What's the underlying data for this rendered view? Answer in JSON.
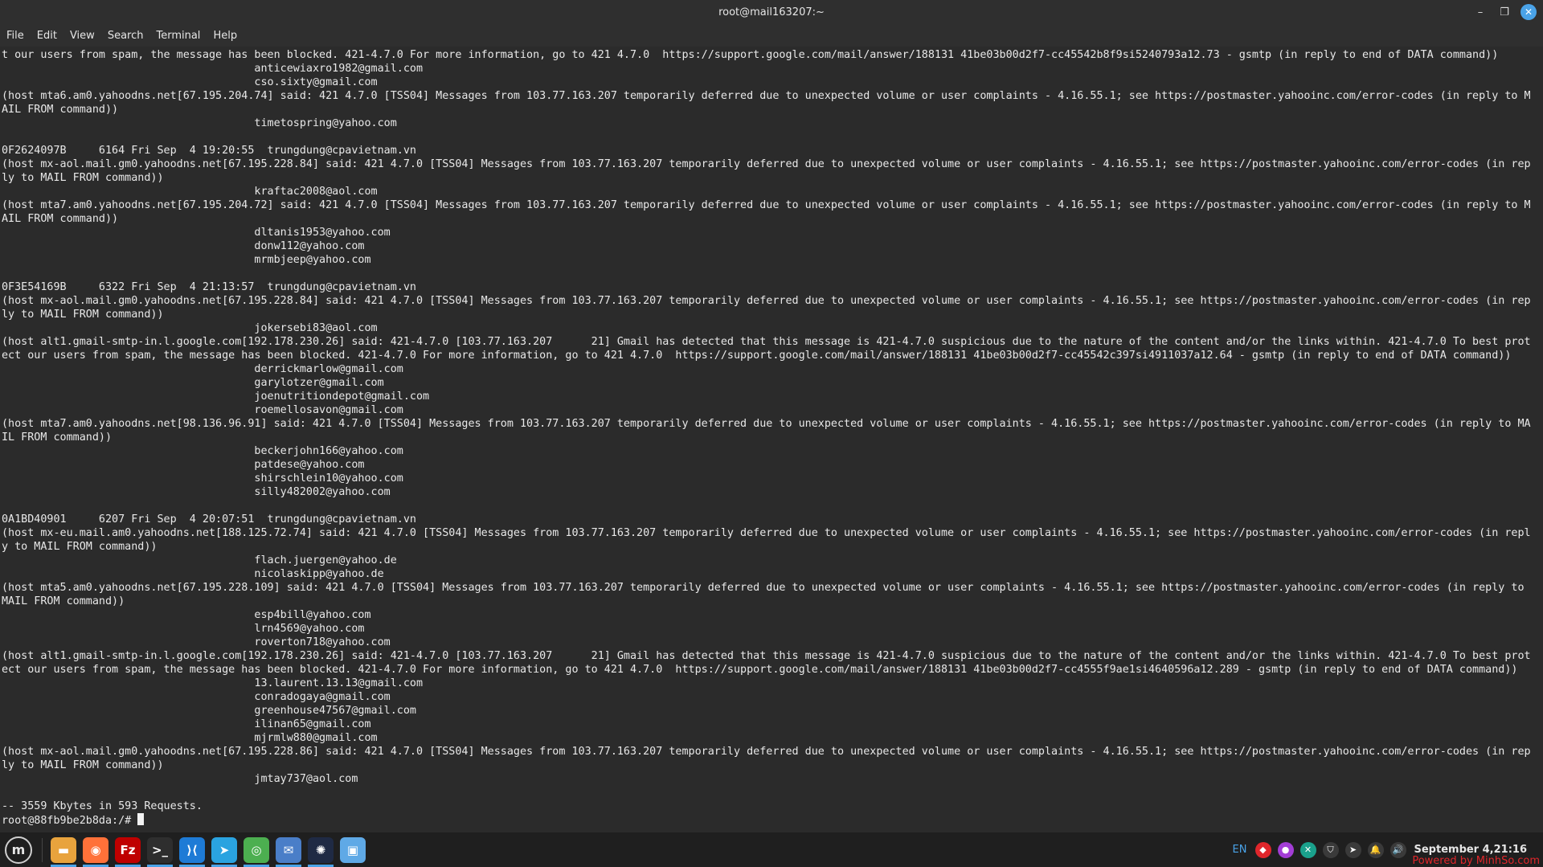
{
  "window": {
    "title": "root@mail163207:~"
  },
  "menu": {
    "items": [
      "File",
      "Edit",
      "View",
      "Search",
      "Terminal",
      "Help"
    ]
  },
  "terminal": {
    "lines": [
      "t our users from spam, the message has been blocked. 421-4.7.0 For more information, go to 421 4.7.0  https://support.google.com/mail/answer/188131 41be03b00d2f7-cc45542b8f9si5240793a12.73 - gsmtp (in reply to end of DATA command))",
      "                                       anticewiaxro1982@gmail.com",
      "                                       cso.sixty@gmail.com",
      "(host mta6.am0.yahoodns.net[67.195.204.74] said: 421 4.7.0 [TSS04] Messages from 103.77.163.207 temporarily deferred due to unexpected volume or user complaints - 4.16.55.1; see https://postmaster.yahooinc.com/error-codes (in reply to MAIL FROM command))",
      "                                       timetospring@yahoo.com",
      "",
      "0F2624097B     6164 Fri Sep  4 19:20:55  trungdung@cpavietnam.vn",
      "(host mx-aol.mail.gm0.yahoodns.net[67.195.228.84] said: 421 4.7.0 [TSS04] Messages from 103.77.163.207 temporarily deferred due to unexpected volume or user complaints - 4.16.55.1; see https://postmaster.yahooinc.com/error-codes (in reply to MAIL FROM command))",
      "                                       kraftac2008@aol.com",
      "(host mta7.am0.yahoodns.net[67.195.204.72] said: 421 4.7.0 [TSS04] Messages from 103.77.163.207 temporarily deferred due to unexpected volume or user complaints - 4.16.55.1; see https://postmaster.yahooinc.com/error-codes (in reply to MAIL FROM command))",
      "                                       dltanis1953@yahoo.com",
      "                                       donw112@yahoo.com",
      "                                       mrmbjeep@yahoo.com",
      "",
      "0F3E54169B     6322 Fri Sep  4 21:13:57  trungdung@cpavietnam.vn",
      "(host mx-aol.mail.gm0.yahoodns.net[67.195.228.84] said: 421 4.7.0 [TSS04] Messages from 103.77.163.207 temporarily deferred due to unexpected volume or user complaints - 4.16.55.1; see https://postmaster.yahooinc.com/error-codes (in reply to MAIL FROM command))",
      "                                       jokersebi83@aol.com",
      "(host alt1.gmail-smtp-in.l.google.com[192.178.230.26] said: 421-4.7.0 [103.77.163.207      21] Gmail has detected that this message is 421-4.7.0 suspicious due to the nature of the content and/or the links within. 421-4.7.0 To best protect our users from spam, the message has been blocked. 421-4.7.0 For more information, go to 421 4.7.0  https://support.google.com/mail/answer/188131 41be03b00d2f7-cc45542c397si4911037a12.64 - gsmtp (in reply to end of DATA command))",
      "                                       derrickmarlow@gmail.com",
      "                                       garylotzer@gmail.com",
      "                                       joenutritiondepot@gmail.com",
      "                                       roemellosavon@gmail.com",
      "(host mta7.am0.yahoodns.net[98.136.96.91] said: 421 4.7.0 [TSS04] Messages from 103.77.163.207 temporarily deferred due to unexpected volume or user complaints - 4.16.55.1; see https://postmaster.yahooinc.com/error-codes (in reply to MAIL FROM command))",
      "                                       beckerjohn166@yahoo.com",
      "                                       patdese@yahoo.com",
      "                                       shirschlein10@yahoo.com",
      "                                       silly482002@yahoo.com",
      "",
      "0A1BD40901     6207 Fri Sep  4 20:07:51  trungdung@cpavietnam.vn",
      "(host mx-eu.mail.am0.yahoodns.net[188.125.72.74] said: 421 4.7.0 [TSS04] Messages from 103.77.163.207 temporarily deferred due to unexpected volume or user complaints - 4.16.55.1; see https://postmaster.yahooinc.com/error-codes (in reply to MAIL FROM command))",
      "                                       flach.juergen@yahoo.de",
      "                                       nicolaskipp@yahoo.de",
      "(host mta5.am0.yahoodns.net[67.195.228.109] said: 421 4.7.0 [TSS04] Messages from 103.77.163.207 temporarily deferred due to unexpected volume or user complaints - 4.16.55.1; see https://postmaster.yahooinc.com/error-codes (in reply to MAIL FROM command))",
      "                                       esp4bill@yahoo.com",
      "                                       lrn4569@yahoo.com",
      "                                       roverton718@yahoo.com",
      "(host alt1.gmail-smtp-in.l.google.com[192.178.230.26] said: 421-4.7.0 [103.77.163.207      21] Gmail has detected that this message is 421-4.7.0 suspicious due to the nature of the content and/or the links within. 421-4.7.0 To best protect our users from spam, the message has been blocked. 421-4.7.0 For more information, go to 421 4.7.0  https://support.google.com/mail/answer/188131 41be03b00d2f7-cc4555f9ae1si4640596a12.289 - gsmtp (in reply to end of DATA command))",
      "                                       13.laurent.13.13@gmail.com",
      "                                       conradogaya@gmail.com",
      "                                       greenhouse47567@gmail.com",
      "                                       ilinan65@gmail.com",
      "                                       mjrmlw880@gmail.com",
      "(host mx-aol.mail.gm0.yahoodns.net[67.195.228.86] said: 421 4.7.0 [TSS04] Messages from 103.77.163.207 temporarily deferred due to unexpected volume or user complaints - 4.16.55.1; see https://postmaster.yahooinc.com/error-codes (in reply to MAIL FROM command))",
      "                                       jmtay737@aol.com",
      "",
      "-- 3559 Kbytes in 593 Requests."
    ],
    "prompt": "root@88fb9be2b8da:/# "
  },
  "taskbar": {
    "menu_icon": "linux-mint-menu-icon",
    "apps": [
      {
        "name": "files-folder-icon",
        "glyph": "▬",
        "color": "#e8a33d"
      },
      {
        "name": "firefox-icon",
        "glyph": "◉",
        "color": "#ff7139"
      },
      {
        "name": "filezilla-icon",
        "glyph": "Fz",
        "color": "#bf0000"
      },
      {
        "name": "terminal-icon",
        "glyph": ">_",
        "color": "#2e2e2e"
      },
      {
        "name": "vscode-icon",
        "glyph": "⟩⟨",
        "color": "#1e7bd6"
      },
      {
        "name": "telegram-icon",
        "glyph": "➤",
        "color": "#2aa3e0"
      },
      {
        "name": "chrome-icon",
        "glyph": "◎",
        "color": "#4caf50"
      },
      {
        "name": "mail-icon",
        "glyph": "✉",
        "color": "#4a7ec8"
      },
      {
        "name": "chatgpt-icon",
        "glyph": "✺",
        "color": "#1f2a44"
      },
      {
        "name": "rdp-icon",
        "glyph": "▣",
        "color": "#5fa9e6"
      }
    ],
    "tray": {
      "language": "EN",
      "icons": [
        {
          "name": "anydesk-icon",
          "glyph": "◆",
          "color": "#e0262b"
        },
        {
          "name": "color-picker-icon",
          "glyph": "●",
          "color": "#a33dd6"
        },
        {
          "name": "sync-icon",
          "glyph": "✕",
          "color": "#1aa18c"
        },
        {
          "name": "shield-icon",
          "glyph": "⛉",
          "color": "#3a3a3a"
        },
        {
          "name": "telegram-tray-icon",
          "glyph": "➤",
          "color": "#3a3a3a"
        },
        {
          "name": "notification-icon",
          "glyph": "🔔",
          "color": "#3a3a3a"
        },
        {
          "name": "volume-icon",
          "glyph": "🔊",
          "color": "#3a3a3a"
        }
      ],
      "clock": "September  4,21:16"
    },
    "watermark": "Powered by MinhSo.com"
  }
}
